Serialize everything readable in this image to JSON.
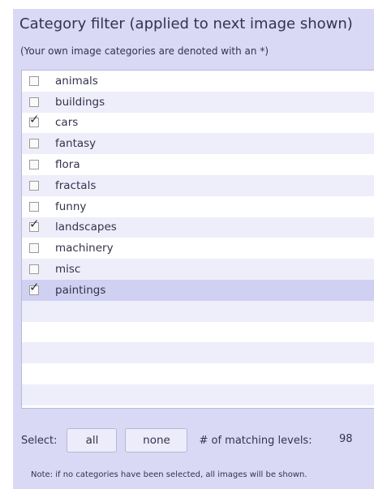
{
  "panel": {
    "title": "Category filter (applied to next image shown)",
    "subtitle": "(Your own image categories are denoted with an *)"
  },
  "categories": [
    {
      "label": "animals",
      "checked": false
    },
    {
      "label": "buildings",
      "checked": false
    },
    {
      "label": "cars",
      "checked": true
    },
    {
      "label": "fantasy",
      "checked": false
    },
    {
      "label": "flora",
      "checked": false
    },
    {
      "label": "fractals",
      "checked": false
    },
    {
      "label": "funny",
      "checked": false
    },
    {
      "label": "landscapes",
      "checked": true
    },
    {
      "label": "machinery",
      "checked": false
    },
    {
      "label": "misc",
      "checked": false
    },
    {
      "label": "paintings",
      "checked": true
    }
  ],
  "footer": {
    "select_label": "Select:",
    "all_button": "all",
    "none_button": "none",
    "matching_label": "# of matching levels:",
    "matching_count": "98",
    "note": "Note: if no categories have been selected, all images will be shown."
  },
  "colors": {
    "panel_bg": "#d9d9f5",
    "row_alt": "#eeeefb",
    "row_selected": "#d0d0f2"
  }
}
